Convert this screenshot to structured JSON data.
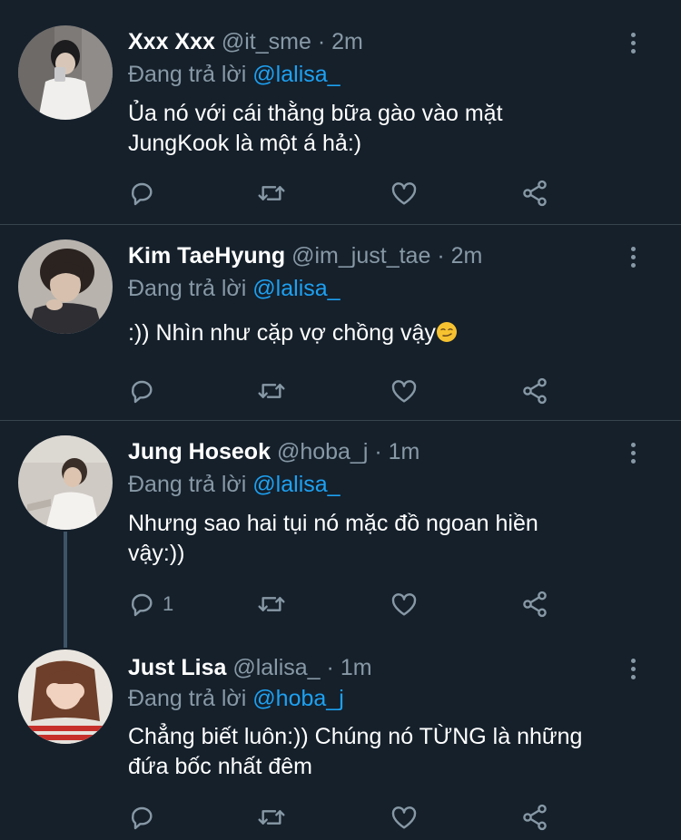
{
  "colors": {
    "background": "#15202b",
    "text": "#ffffff",
    "secondary_text": "#8899a6",
    "mention": "#1da1f2",
    "divider": "#38444d",
    "thread_line": "#3d5466"
  },
  "icons": {
    "reply": "reply-icon",
    "retweet": "retweet-icon",
    "like": "like-icon",
    "share": "share-icon",
    "more": "more-icon",
    "emoji": "smirking-face-emoji"
  },
  "reply_prefix": "Đang trả lời",
  "tweets": [
    {
      "name": "Xxx Xxx",
      "handle": "@it_sme",
      "separator": "·",
      "time": "2m",
      "reply_to": "@lalisa_",
      "text_line1": "Ủa nó với cái thằng bữa gào vào mặt",
      "text_line2": "JungKook là một á hả:)",
      "reply_count": ""
    },
    {
      "name": "Kim TaeHyung",
      "handle": "@im_just_tae",
      "separator": "·",
      "time": "2m",
      "reply_to": "@lalisa_",
      "text_line1": ":)) Nhìn như cặp vợ chồng vậy",
      "reply_count": ""
    },
    {
      "name": "Jung Hoseok",
      "handle": "@hoba_j",
      "separator": "·",
      "time": "1m",
      "reply_to": "@lalisa_",
      "text_line1": "Nhưng sao hai tụi nó mặc đồ ngoan hiền",
      "text_line2": "vậy:))",
      "reply_count": "1"
    },
    {
      "name": "Just Lisa",
      "handle": "@lalisa_",
      "separator": "·",
      "time": "1m",
      "reply_to": "@hoba_j",
      "text_line1": "Chẳng biết luôn:)) Chúng nó TỪNG là những",
      "text_line2": "đứa bốc nhất đêm",
      "reply_count": ""
    }
  ]
}
